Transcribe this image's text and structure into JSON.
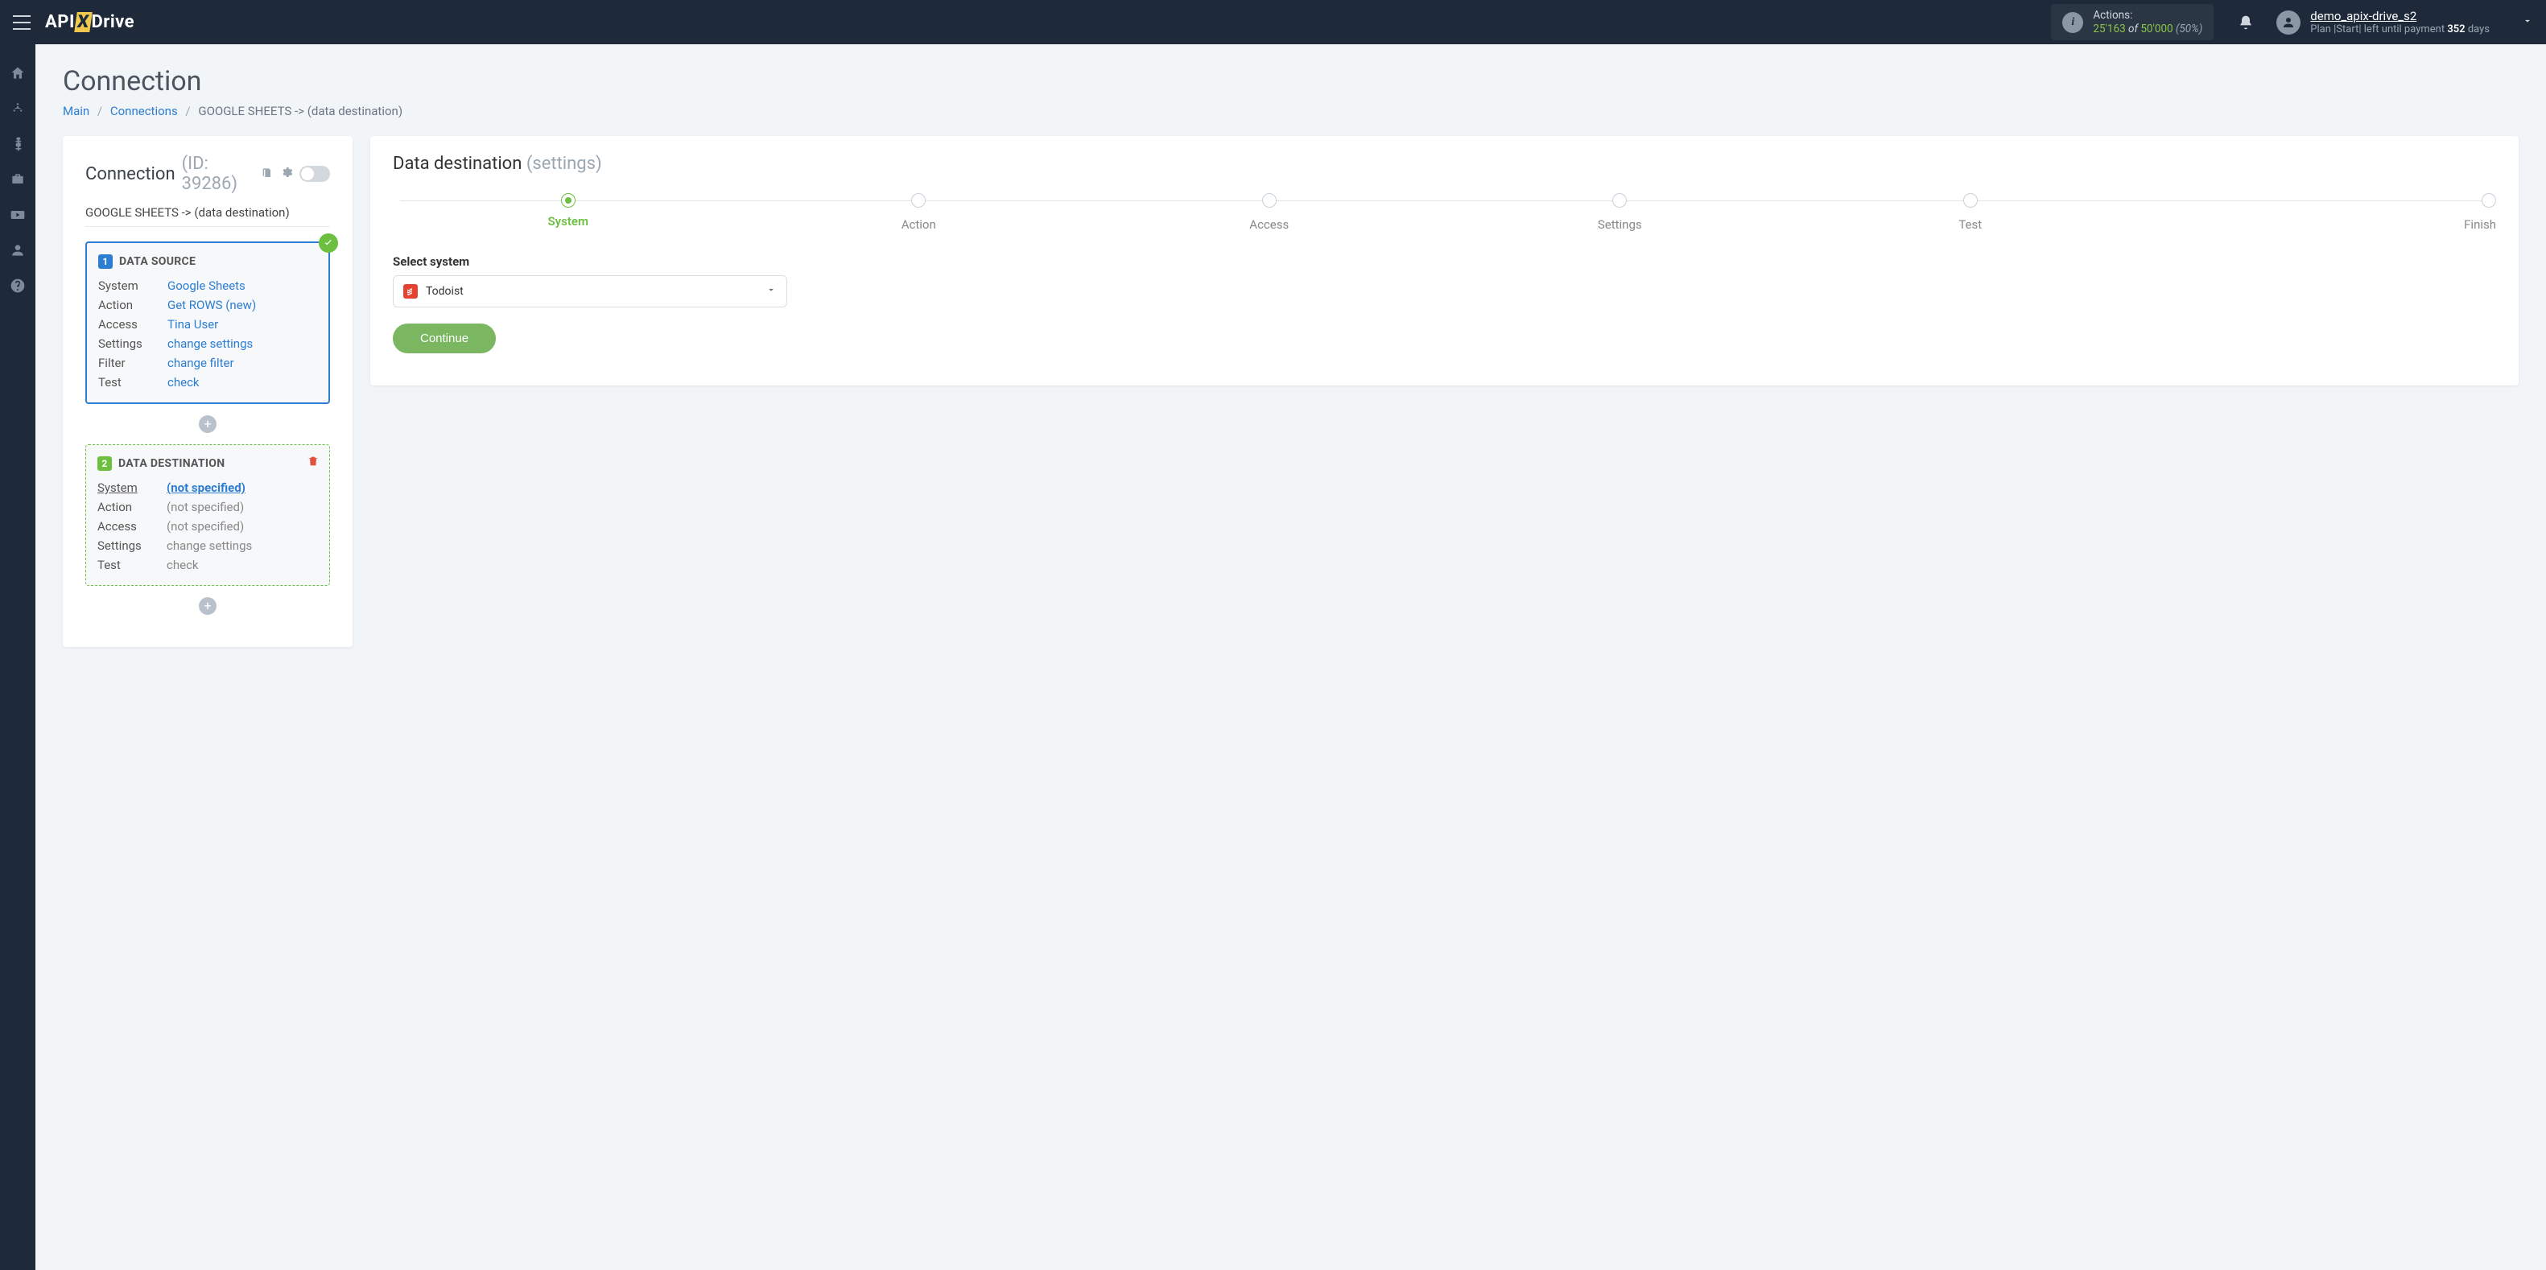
{
  "header": {
    "logo_api": "API",
    "logo_x": "X",
    "logo_drive": "Drive",
    "actions_label": "Actions:",
    "actions_used": "25'163",
    "actions_of": " of ",
    "actions_total": "50'000",
    "actions_pct": " (50%)",
    "user_name": "demo_apix-drive_s2",
    "plan_prefix": "Plan |Start| left until payment ",
    "plan_days": "352",
    "plan_suffix": " days"
  },
  "breadcrumb": {
    "main": "Main",
    "connections": "Connections",
    "current": "GOOGLE SHEETS -> (data destination)"
  },
  "page_title": "Connection",
  "left": {
    "title": "Connection",
    "id": "(ID: 39286)",
    "subtitle": "GOOGLE SHEETS -> (data destination)",
    "source": {
      "num": "1",
      "title": "DATA SOURCE",
      "rows": {
        "system_k": "System",
        "system_v": "Google Sheets",
        "action_k": "Action",
        "action_v": "Get ROWS (new)",
        "access_k": "Access",
        "access_v": "Tina User",
        "settings_k": "Settings",
        "settings_v": "change settings",
        "filter_k": "Filter",
        "filter_v": "change filter",
        "test_k": "Test",
        "test_v": "check"
      }
    },
    "dest": {
      "num": "2",
      "title": "DATA DESTINATION",
      "rows": {
        "system_k": "System",
        "system_v": "(not specified)",
        "action_k": "Action",
        "action_v": "(not specified)",
        "access_k": "Access",
        "access_v": "(not specified)",
        "settings_k": "Settings",
        "settings_v": "change settings",
        "test_k": "Test",
        "test_v": "check"
      }
    },
    "plus": "+"
  },
  "right": {
    "title": "Data destination",
    "title_sub": "(settings)",
    "steps": [
      "System",
      "Action",
      "Access",
      "Settings",
      "Test",
      "Finish"
    ],
    "active_step_index": 0,
    "select_label": "Select system",
    "selected_system": "Todoist",
    "continue": "Continue"
  }
}
